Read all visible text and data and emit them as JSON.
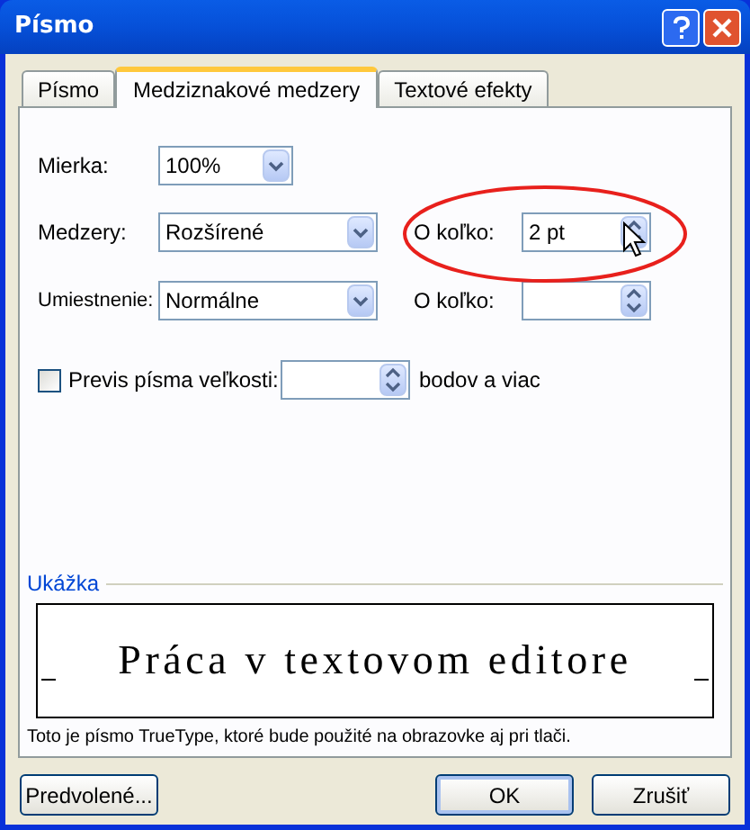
{
  "window": {
    "title": "Písmo"
  },
  "tabs": [
    {
      "label": "Písmo",
      "selected": false
    },
    {
      "label": "Medziznakové medzery",
      "selected": true
    },
    {
      "label": "Textové efekty",
      "selected": false
    }
  ],
  "scale": {
    "label": "Mierka:",
    "value": "100%"
  },
  "spacing": {
    "label": "Medzery:",
    "value": "Rozšírené",
    "by_label": "O koľko:",
    "by_value": "2 pt",
    "highlighted": true
  },
  "position": {
    "label": "Umiestnenie:",
    "value": "Normálne",
    "by_label": "O koľko:"
  },
  "kerning": {
    "label": "Previs písma veľkosti:",
    "checked": false,
    "suffix": "bodov a viac"
  },
  "preview": {
    "label": "Ukážka",
    "text": "Práca v textovom editore",
    "note": "Toto je písmo TrueType, ktoré bude použité na obrazovke aj pri tlači."
  },
  "buttons": [
    {
      "label": "Predvolené...",
      "default": false
    },
    {
      "label": "OK",
      "default": true
    },
    {
      "label": "Zrušiť",
      "default": false
    }
  ]
}
